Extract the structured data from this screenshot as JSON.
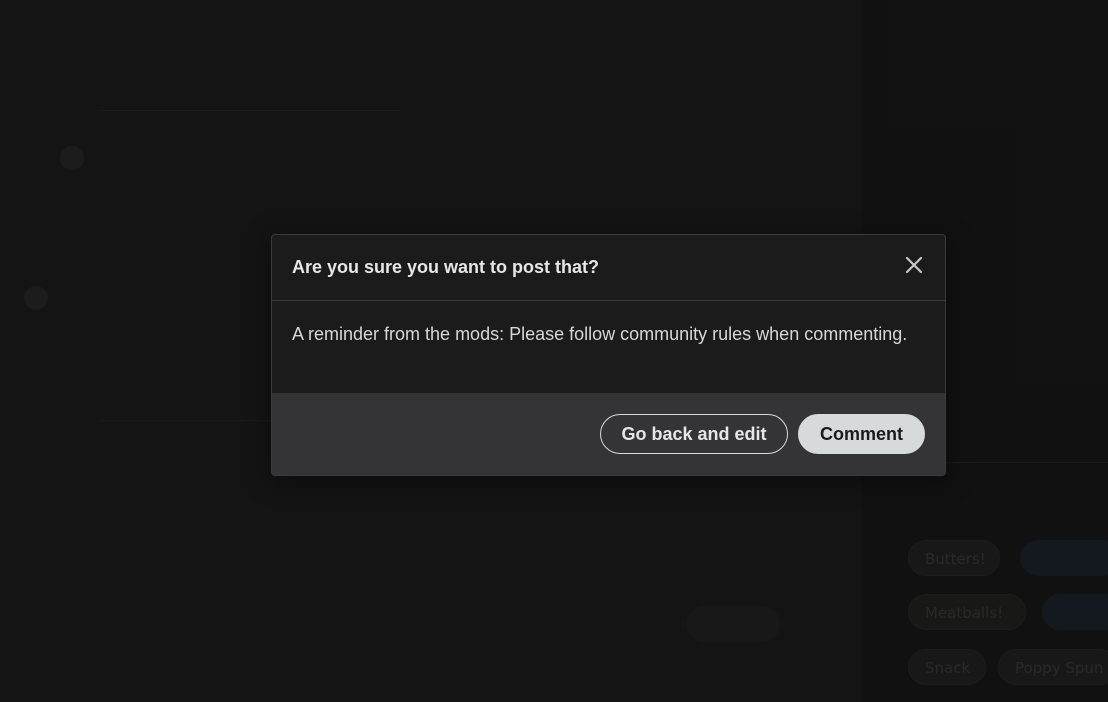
{
  "modal": {
    "title": "Are you sure you want to post that?",
    "message": "A reminder from the mods: Please follow community rules when commenting.",
    "buttons": {
      "back": "Go back and edit",
      "comment": "Comment"
    },
    "close_icon": "close-icon"
  },
  "background": {
    "sidebar_tags": [
      "Butters!",
      "Meatballs!",
      "Snack",
      "Poppy Spun"
    ]
  },
  "colors": {
    "modal_bg": "#1b1b1b",
    "footer_bg": "#343436",
    "primary_button_bg": "#d7dadc",
    "text": "#e6e6e6"
  }
}
